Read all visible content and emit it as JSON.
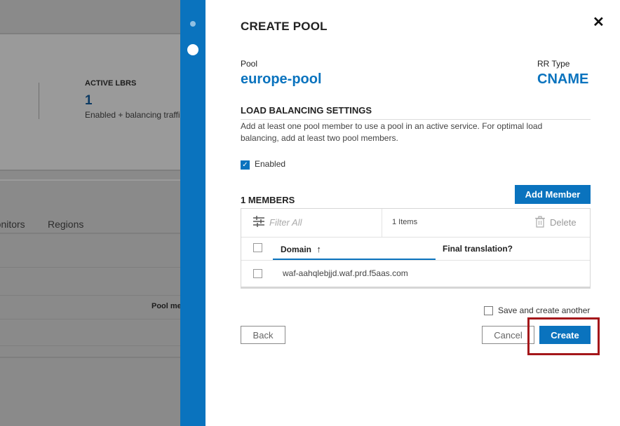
{
  "background": {
    "active_lbrs_label": "ACTIVE LBRS",
    "active_lbrs_value": "1",
    "active_lbrs_sub": "Enabled + balancing traffic",
    "tab_monitors": "Monitors",
    "tab_regions": "Regions",
    "col_pool_members": "Pool members"
  },
  "modal": {
    "title": "CREATE POOL",
    "close_icon": "✕",
    "pool_label": "Pool",
    "pool_name": "europe-pool",
    "rr_type_label": "RR Type",
    "rr_type_value": "CNAME",
    "lb_settings_title": "LOAD BALANCING SETTINGS",
    "lb_settings_desc": "Add at least one pool member to use a pool in an active service. For optimal load balancing, add at least two pool members.",
    "enabled_label": "Enabled",
    "enabled_checked": true,
    "members_title": "1 MEMBERS",
    "add_member_label": "Add Member",
    "table": {
      "filter_placeholder": "Filter All",
      "filter_icon": "sliders-icon",
      "items_count": "1 Items",
      "delete_label": "Delete",
      "delete_icon": "trash-icon",
      "columns": [
        "Domain",
        "Final translation?"
      ],
      "sort_indicator": "↑",
      "rows": [
        {
          "domain": "waf-aahqlebjjd.waf.prd.f5aas.com",
          "final_translation": ""
        }
      ]
    },
    "save_and_create_another_label": "Save and create another",
    "back_label": "Back",
    "cancel_label": "Cancel",
    "create_label": "Create"
  },
  "colors": {
    "accent": "#0a73be",
    "highlight": "#a4161a",
    "overlay": "#8a8a8a"
  }
}
